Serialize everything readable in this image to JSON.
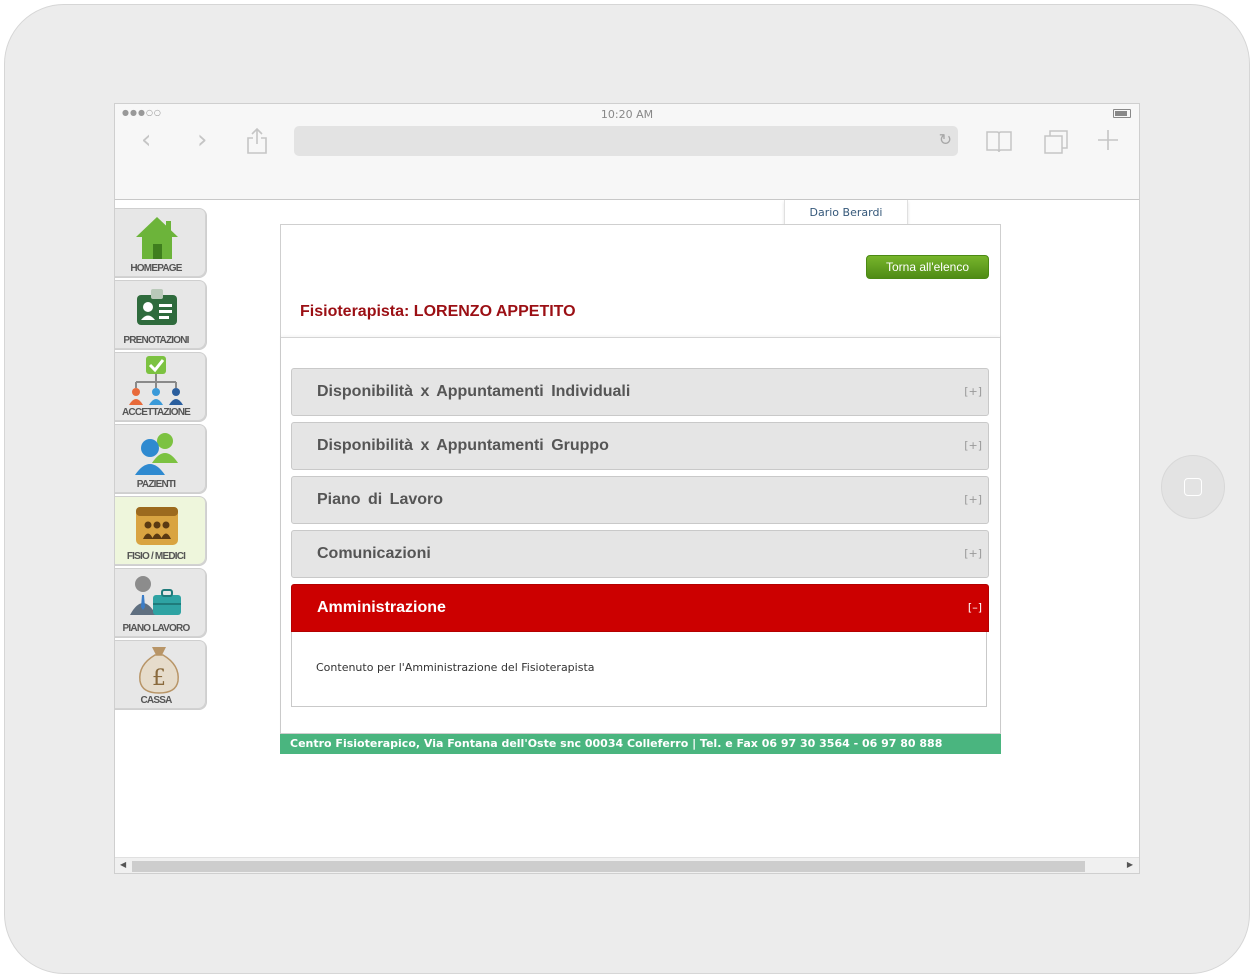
{
  "status_bar": {
    "time": "10:20 AM",
    "signal": "●●●○○"
  },
  "toolbar": {
    "back_icon": "‹",
    "forward_icon": "›"
  },
  "nav": {
    "items": [
      {
        "label": "HOMEPAGE",
        "icon": "house-icon",
        "active": false
      },
      {
        "label": "PRENOTAZIONI",
        "icon": "id-card-icon",
        "active": false
      },
      {
        "label": "ACCETTAZIONE",
        "icon": "org-chart-icon",
        "active": false
      },
      {
        "label": "PAZIENTI",
        "icon": "users-icon",
        "active": false
      },
      {
        "label": "FISIO / MEDICI",
        "icon": "calendar-staff-icon",
        "active": true
      },
      {
        "label": "PIANO LAVORO",
        "icon": "briefcase-user-icon",
        "active": false
      },
      {
        "label": "CASSA",
        "icon": "money-bag-icon",
        "active": false
      }
    ]
  },
  "user": {
    "name": "Dario Berardi"
  },
  "header": {
    "back_button": "Torna all'elenco",
    "title": "Fisioterapista: LORENZO APPETITO"
  },
  "accordion": {
    "sections": [
      {
        "label": "Disponibilità x Appuntamenti Individuali",
        "toggle": "[+]",
        "open": false
      },
      {
        "label": "Disponibilità x Appuntamenti Gruppo",
        "toggle": "[+]",
        "open": false
      },
      {
        "label": "Piano di Lavoro",
        "toggle": "[+]",
        "open": false
      },
      {
        "label": "Comunicazioni",
        "toggle": "[+]",
        "open": false
      },
      {
        "label": "Amministrazione",
        "toggle": "[–]",
        "open": true
      }
    ],
    "open_content": "Contenuto per l'Amministrazione del Fisioterapista"
  },
  "footer": {
    "text": "Centro Fisioterapico, Via Fontana dell'Oste snc 00034 Colleferro | Tel. e Fax 06 97 30 3564 - 06 97 80 888"
  },
  "colors": {
    "accent_red": "#cc0000",
    "title_red": "#9b0f14",
    "footer_green": "#4ab57f",
    "button_green": "#5f9e1e"
  }
}
